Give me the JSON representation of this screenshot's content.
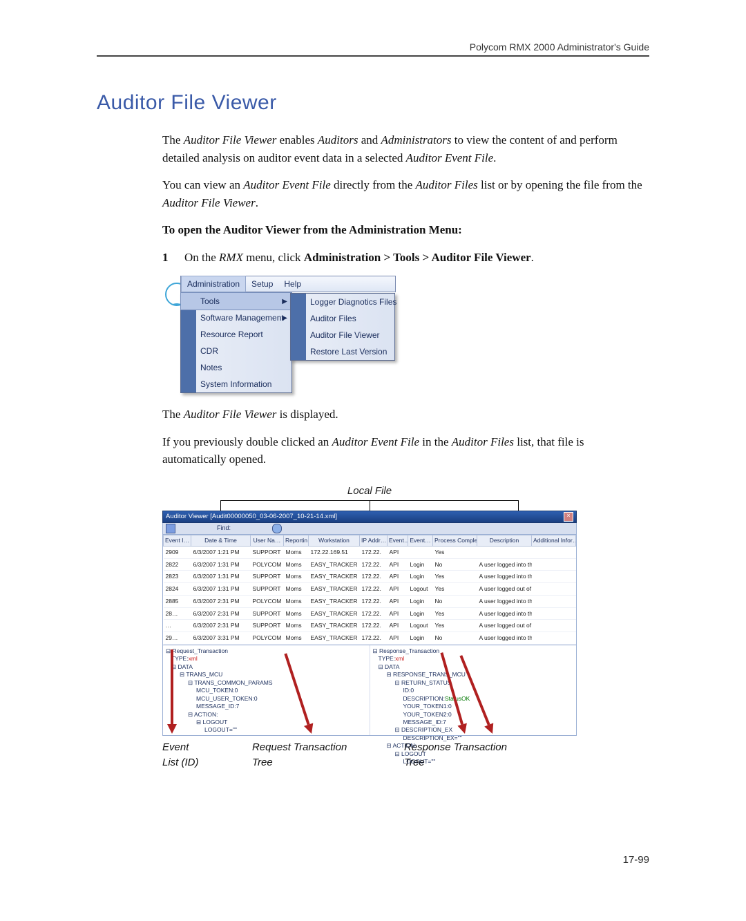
{
  "header": {
    "running": "Polycom RMX 2000 Administrator's Guide"
  },
  "title": "Auditor File Viewer",
  "para1a": "The ",
  "para1b": "Auditor File Viewer",
  "para1c": " enables ",
  "para1d": "Auditors",
  "para1e": " and ",
  "para1f": "Administrators",
  "para1g": " to view the content of and perform detailed analysis on auditor event data in a selected ",
  "para1h": "Auditor Event File",
  "para1i": ".",
  "para2a": "You can view an ",
  "para2b": "Auditor Event File",
  "para2c": " directly from the ",
  "para2d": "Auditor Files",
  "para2e": " list or by opening the file from the ",
  "para2f": "Auditor File Viewer",
  "para2g": ".",
  "lead_in": "To open the Auditor Viewer from the Administration Menu:",
  "step1_num": "1",
  "step1a": "On the ",
  "step1b": "RMX",
  "step1c": " menu, click ",
  "step1d": "Administration > Tools > Auditor File Viewer",
  "step1e": ".",
  "menubar": {
    "items": [
      "Administration",
      "Setup",
      "Help"
    ],
    "dropdown": [
      {
        "label": "Tools",
        "arrow": "▶"
      },
      {
        "label": "Software Management",
        "arrow": "▶"
      },
      {
        "label": "Resource Report"
      },
      {
        "label": "CDR"
      },
      {
        "label": "Notes"
      },
      {
        "label": "System Information"
      }
    ],
    "submenu": [
      "Logger Diagnotics Files",
      "Auditor Files",
      "Auditor File Viewer",
      "Restore Last Version"
    ]
  },
  "after1a": "The ",
  "after1b": "Auditor File Viewer",
  "after1c": " is displayed.",
  "after2a": "If you previously double clicked an ",
  "after2b": "Auditor Event File",
  "after2c": " in the ",
  "after2d": "Auditor Files",
  "after2e": " list, that file is automatically opened.",
  "viewer": {
    "local_file_label": "Local File",
    "window_title": "Auditor Viewer [Audit00000050_03-06-2007_10-21-14.xml]",
    "find_label": "Find:",
    "columns": [
      "Event I…",
      "Date & Time",
      "User Na…",
      "Reportin…",
      "Workstation",
      "IP Addr…",
      "Event…",
      "Event…",
      "Process Completed",
      "Description",
      "Additional Infor…"
    ],
    "rows": [
      {
        "id": "2909",
        "dt": "6/3/2007 1:21 PM",
        "user": "SUPPORT",
        "rep": "Moms",
        "ws": "172.22.169.51",
        "ip": "172.22.",
        "evt": "API",
        "evt2": "",
        "proc": "Yes",
        "desc": ""
      },
      {
        "id": "2822",
        "dt": "6/3/2007 1:31 PM",
        "user": "POLYCOM",
        "rep": "Moms",
        "ws": "EASY_TRACKER",
        "ip": "172.22.",
        "evt": "API",
        "evt2": "Login",
        "proc": "No",
        "desc": "A user logged into the RMX."
      },
      {
        "id": "2823",
        "dt": "6/3/2007 1:31 PM",
        "user": "SUPPORT",
        "rep": "Moms",
        "ws": "EASY_TRACKER",
        "ip": "172.22.",
        "evt": "API",
        "evt2": "Login",
        "proc": "Yes",
        "desc": "A user logged into the RMX."
      },
      {
        "id": "2824",
        "dt": "6/3/2007 1:31 PM",
        "user": "SUPPORT",
        "rep": "Moms",
        "ws": "EASY_TRACKER",
        "ip": "172.22.",
        "evt": "API",
        "evt2": "Logout",
        "proc": "Yes",
        "desc": "A user logged out of the RMX."
      },
      {
        "id": "2885",
        "dt": "6/3/2007 2:31 PM",
        "user": "POLYCOM",
        "rep": "Moms",
        "ws": "EASY_TRACKER",
        "ip": "172.22.",
        "evt": "API",
        "evt2": "Login",
        "proc": "No",
        "desc": "A user logged into the RMX."
      },
      {
        "id": "28…",
        "dt": "6/3/2007 2:31 PM",
        "user": "SUPPORT",
        "rep": "Moms",
        "ws": "EASY_TRACKER",
        "ip": "172.22.",
        "evt": "API",
        "evt2": "Login",
        "proc": "Yes",
        "desc": "A user logged into the RMX."
      },
      {
        "id": "…",
        "dt": "6/3/2007 2:31 PM",
        "user": "SUPPORT",
        "rep": "Moms",
        "ws": "EASY_TRACKER",
        "ip": "172.22.",
        "evt": "API",
        "evt2": "Logout",
        "proc": "Yes",
        "desc": "A user logged out of the RMX."
      },
      {
        "id": "29…",
        "dt": "6/3/2007 3:31 PM",
        "user": "POLYCOM",
        "rep": "Moms",
        "ws": "EASY_TRACKER",
        "ip": "172.22.",
        "evt": "API",
        "evt2": "Login",
        "proc": "No",
        "desc": "A user logged into the RMX."
      }
    ],
    "req_tree": {
      "root": "Request_Transaction",
      "l1a": "TYPE:",
      "l1a_v": "xml",
      "l1b": "DATA",
      "l2a": "TRANS_MCU",
      "l3a": "TRANS_COMMON_PARAMS",
      "l4a": "MCU_TOKEN:0",
      "l4b": "MCU_USER_TOKEN:0",
      "l4c": "MESSAGE_ID:7",
      "l3b": "ACTION:",
      "l4d": "LOGOUT",
      "l5a": "LOGOUT=\"\""
    },
    "resp_tree": {
      "root": "Response_Transaction",
      "l1a": "TYPE:",
      "l1a_v": "xml",
      "l1b": "DATA",
      "l2a": "RESPONSE_TRANS_MCU",
      "l3a": "RETURN_STATUS",
      "l4a": "ID:0",
      "l4b": "DESCRIPTION:",
      "l4b_v": "StatusOK",
      "l4c": "YOUR_TOKEN1:0",
      "l4d": "YOUR_TOKEN2:0",
      "l4e": "MESSAGE_ID:7",
      "l3b": "DESCRIPTION_EX",
      "l4f": "DESCRIPTION_EX=\"\"",
      "l2b": "ACTION:",
      "l3c": "LOGOUT",
      "l4g": "LOGOUT=\"\""
    }
  },
  "callouts": {
    "c1a": "Event",
    "c1b": "List (ID)",
    "c2a": "Request Transaction",
    "c2b": "Tree",
    "c3a": "Response Transaction",
    "c3b": "Tree"
  },
  "page_num": "17-99"
}
